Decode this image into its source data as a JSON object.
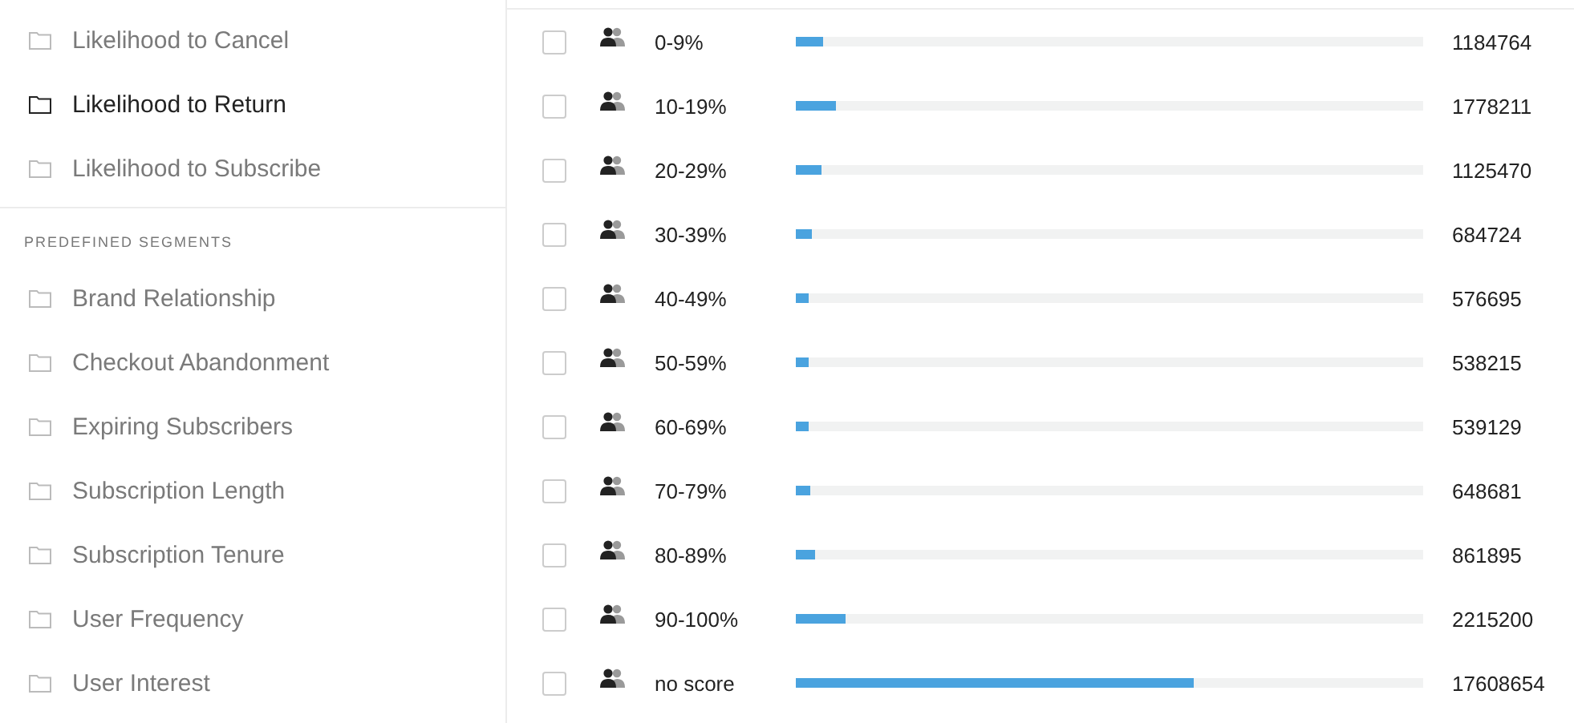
{
  "sidebar": {
    "items": [
      {
        "label": "Likelihood to Cancel",
        "selected": false
      },
      {
        "label": "Likelihood to Return",
        "selected": true
      },
      {
        "label": "Likelihood to Subscribe",
        "selected": false
      }
    ],
    "section_title": "PREDEFINED SEGMENTS",
    "predefined": [
      {
        "label": "Brand Relationship",
        "selected": false
      },
      {
        "label": "Checkout Abandonment",
        "selected": false
      },
      {
        "label": "Expiring Subscribers",
        "selected": false
      },
      {
        "label": "Subscription Length",
        "selected": false
      },
      {
        "label": "Subscription Tenure",
        "selected": false
      },
      {
        "label": "User Frequency",
        "selected": false
      },
      {
        "label": "User Interest",
        "selected": false
      }
    ]
  },
  "rows": [
    {
      "label": "0-9%",
      "level": 0.043,
      "count": "1184764",
      "checked": false
    },
    {
      "label": "10-19%",
      "level": 0.064,
      "count": "1778211",
      "checked": false
    },
    {
      "label": "20-29%",
      "level": 0.041,
      "count": "1125470",
      "checked": false
    },
    {
      "label": "30-39%",
      "level": 0.026,
      "count": "684724",
      "checked": false
    },
    {
      "label": "40-49%",
      "level": 0.02,
      "count": "576695",
      "checked": false
    },
    {
      "label": "50-59%",
      "level": 0.02,
      "count": "538215",
      "checked": false
    },
    {
      "label": "60-69%",
      "level": 0.02,
      "count": "539129",
      "checked": false
    },
    {
      "label": "70-79%",
      "level": 0.023,
      "count": "648681",
      "checked": false
    },
    {
      "label": "80-89%",
      "level": 0.031,
      "count": "861895",
      "checked": false
    },
    {
      "label": "90-100%",
      "level": 0.079,
      "count": "2215200",
      "checked": false
    },
    {
      "label": "no score",
      "level": 0.634,
      "count": "17608654",
      "checked": false
    }
  ]
}
